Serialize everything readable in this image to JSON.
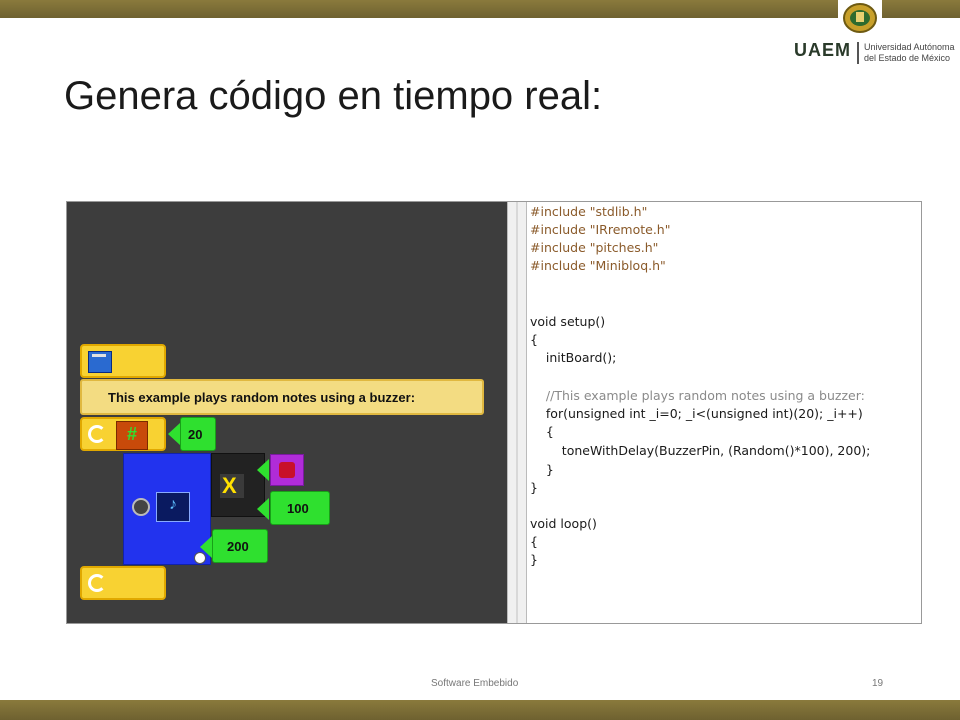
{
  "slide": {
    "title": "Genera código en tiempo real:",
    "footer": "Software Embebido",
    "page_number": "19"
  },
  "logo": {
    "acronym": "UAEM",
    "line1": "Universidad Autónoma",
    "line2": "del Estado de México"
  },
  "blocks": {
    "comment": "This example plays random notes using a buzzer:",
    "repeat_count": "20",
    "multiply_value": "100",
    "multiply_symbol": "X",
    "delay_value": "200",
    "hash_symbol": "#"
  },
  "code": {
    "lines": [
      "#include \"stdlib.h\"",
      "#include \"IRremote.h\"",
      "#include \"pitches.h\"",
      "#include \"Minibloq.h\"",
      "",
      "void setup()",
      "{",
      "    initBoard();",
      "",
      "    //This example plays random notes using a buzzer:",
      "    for(unsigned int _i=0; _i<(unsigned int)(20); _i++)",
      "    {",
      "        toneWithDelay(BuzzerPin, (Random()*100), 200);",
      "    }",
      "}",
      "",
      "void loop()",
      "{",
      "}"
    ]
  },
  "colors": {
    "bar": "#7a6c34",
    "block_yellow": "#f8d232",
    "block_green": "#2fe02f",
    "block_blue": "#2233ee",
    "keyword": "#2b54c9",
    "number": "#1aa33a"
  }
}
